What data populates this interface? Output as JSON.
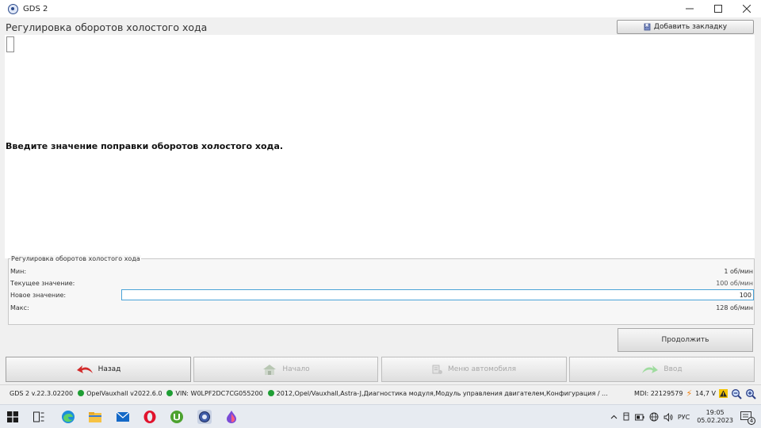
{
  "window": {
    "title": "GDS 2"
  },
  "header": {
    "title": "Регулировка оборотов холостого хода",
    "bookmark_label": "Добавить закладку"
  },
  "content": {
    "prompt": "Введите значение поправки оборотов холостого хода."
  },
  "group": {
    "legend": "Регулировка оборотов холостого хода",
    "rows": [
      {
        "label": "Мин:",
        "value": "1 об/мин"
      },
      {
        "label": "Текущее значение:",
        "value": "100 об/мин"
      },
      {
        "label": "Новое значение:",
        "value": "100"
      },
      {
        "label": "Макс:",
        "value": "128 об/мин"
      }
    ]
  },
  "continue_label": "Продолжить",
  "nav": {
    "back": "Назад",
    "home": "Начало",
    "vehicle_menu": "Меню автомобиля",
    "enter": "Ввод"
  },
  "status": {
    "version": "GDS 2 v.22.3.02200",
    "database": "OpelVauxhall v2022.6.0",
    "vin": "VIN: W0LPF2DC7CG055200",
    "path": "2012,Opel/Vauxhall,Astra-J,Диагностика модуля,Модуль управления двигателем,Конфигурация / ...",
    "mdi": "MDI: 22129579",
    "voltage": "14,7 V"
  },
  "taskbar": {
    "lang": "РУС",
    "time": "19:05",
    "date": "05.02.2023",
    "notifications": "4"
  },
  "colors": {
    "accent": "#4aa3d8",
    "ok_dot": "#1f9e34",
    "back_arrow": "#d22a2a",
    "bolt": "#f2820f"
  }
}
